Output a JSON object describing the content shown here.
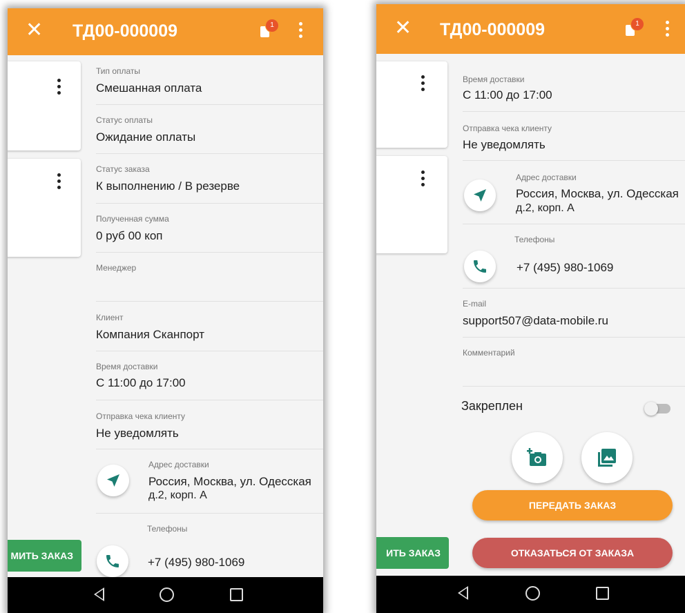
{
  "app": {
    "title": "ТД00-000009",
    "badge_count": "1",
    "accent_color": "#f59a2d",
    "icons": {
      "close": "close-icon",
      "doc": "document-icon",
      "menu": "more-vert-icon"
    }
  },
  "fields": {
    "payment_type": {
      "label": "Тип оплаты",
      "value": "Смешанная оплата"
    },
    "payment_status": {
      "label": "Статус оплаты",
      "value": "Ожидание оплаты"
    },
    "order_status": {
      "label": "Статус заказа",
      "value": "К выполнению / В резерве"
    },
    "received_sum": {
      "label": "Полученная сумма",
      "value": "0 руб 00 коп"
    },
    "manager": {
      "label": "Менеджер",
      "value": ""
    },
    "client": {
      "label": "Клиент",
      "value": "Компания Сканпорт"
    },
    "delivery_time": {
      "label": "Время доставки",
      "value": "С 11:00 до 17:00"
    },
    "receipt": {
      "label": "Отправка чека клиенту",
      "value": "Не уведомлять"
    },
    "address": {
      "label": "Адрес доставки",
      "line1": "Россия, Москва, ул. Одесская",
      "line2": "д.2, корп. А"
    },
    "phones": {
      "label": "Телефоны",
      "value": "+7 (495) 980-1069"
    },
    "email": {
      "label": "E-mail",
      "value": "support507@data-mobile.ru"
    },
    "comment": {
      "label": "Комментарий",
      "value": ""
    }
  },
  "pinned": {
    "label": "Закреплен",
    "on": false
  },
  "buttons": {
    "confirm_partial_left": "МИТЬ ЗАКАЗ",
    "confirm_partial_right": "ИТЬ ЗАКАЗ",
    "transfer": "ПЕРЕДАТЬ ЗАКАЗ",
    "refuse": "ОТКАЗАТЬСЯ ОТ ЗАКАЗА"
  },
  "colors": {
    "transfer": "#f59a2d",
    "refuse": "#c95a57",
    "confirm": "#3aa25a",
    "icon_green": "#1b7e72"
  }
}
